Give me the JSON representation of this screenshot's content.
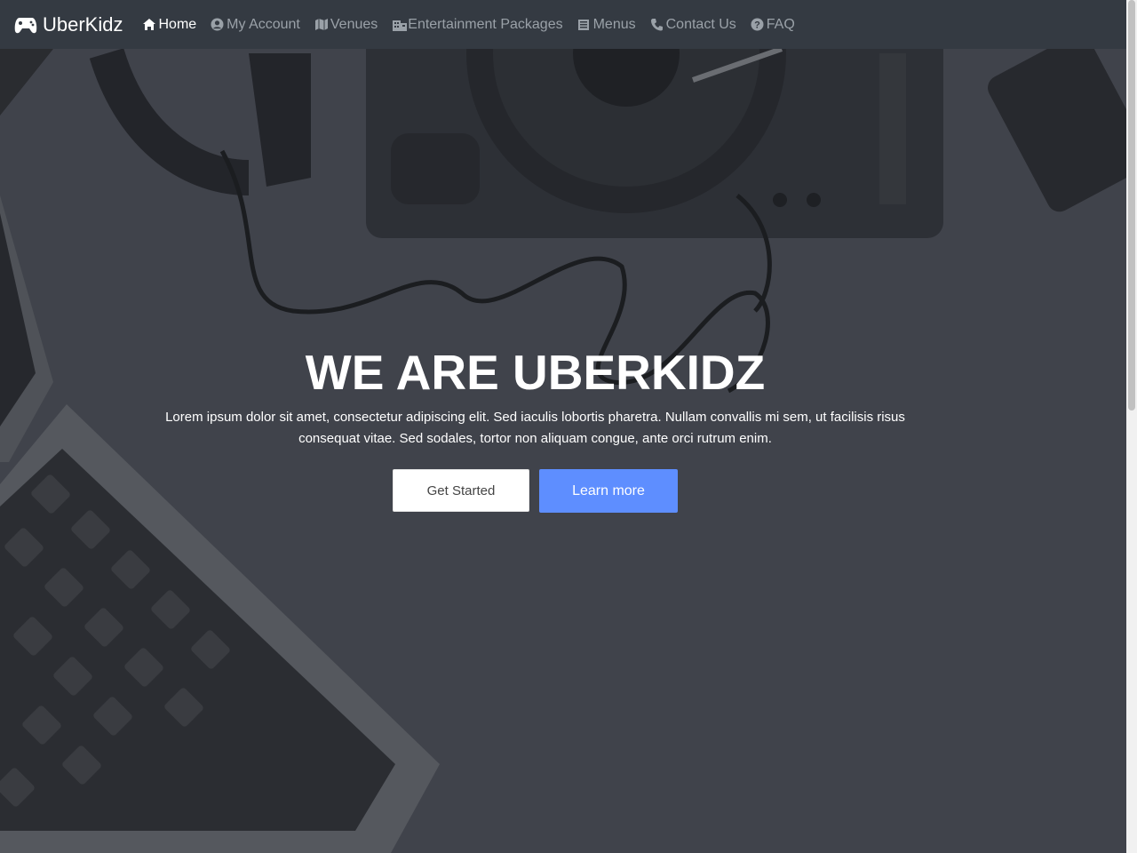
{
  "navbar": {
    "brand": "UberKidz",
    "brand_icon": "gamepad-icon",
    "items": [
      {
        "label": "Home",
        "icon": "home-icon",
        "active": true
      },
      {
        "label": "My Account",
        "icon": "user-circle-icon",
        "active": false
      },
      {
        "label": "Venues",
        "icon": "map-icon",
        "active": false
      },
      {
        "label": "Entertainment Packages",
        "icon": "building-icon",
        "active": false
      },
      {
        "label": "Menus",
        "icon": "list-icon",
        "active": false
      },
      {
        "label": "Contact Us",
        "icon": "phone-icon",
        "active": false
      },
      {
        "label": "FAQ",
        "icon": "question-circle-icon",
        "active": false
      }
    ]
  },
  "hero": {
    "title": "WE ARE UBERKIDZ",
    "text": "Lorem ipsum dolor sit amet, consectetur adipiscing elit. Sed iaculis lobortis pharetra. Nullam convallis mi sem, ut facilisis risus consequat vitae. Sed sodales, tortor non aliquam congue, ante orci rutrum enim.",
    "primary_button": "Learn more",
    "secondary_button": "Get Started"
  },
  "colors": {
    "navbar_bg": "#343a42",
    "overlay_bg": "#40434b",
    "accent": "#5e8eff",
    "nav_text": "#9aa1a8"
  }
}
